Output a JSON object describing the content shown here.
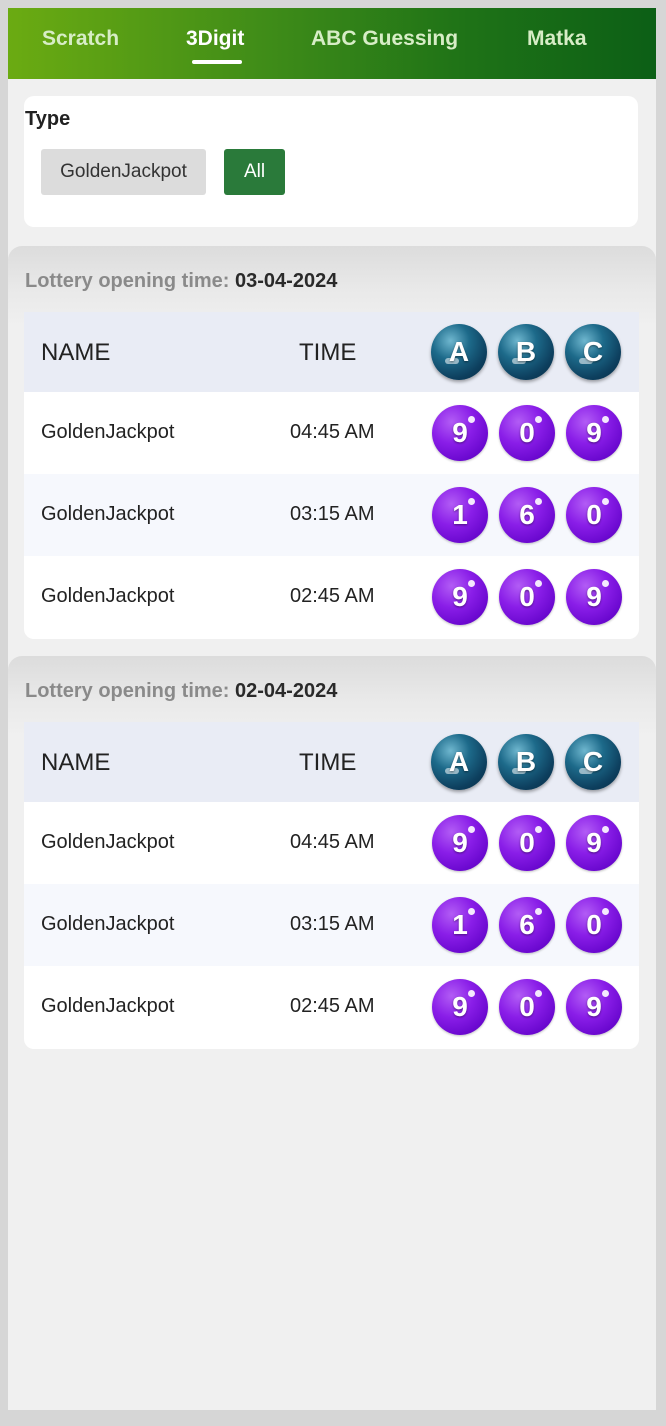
{
  "nav": {
    "tabs": [
      {
        "label": "Scratch"
      },
      {
        "label": "3Digit"
      },
      {
        "label": "ABC Guessing"
      },
      {
        "label": "Matka"
      }
    ],
    "active_index": 1
  },
  "filter": {
    "title": "Type",
    "options": [
      {
        "label": "GoldenJackpot",
        "selected": false
      },
      {
        "label": "All",
        "selected": true
      }
    ]
  },
  "sections": [
    {
      "label": "Lottery opening time:",
      "date": "03-04-2024",
      "headers": {
        "name": "NAME",
        "time": "TIME",
        "a": "A",
        "b": "B",
        "c": "C"
      },
      "rows": [
        {
          "name": "GoldenJackpot",
          "time": "04:45 AM",
          "a": "9",
          "b": "0",
          "c": "9"
        },
        {
          "name": "GoldenJackpot",
          "time": "03:15 AM",
          "a": "1",
          "b": "6",
          "c": "0"
        },
        {
          "name": "GoldenJackpot",
          "time": "02:45 AM",
          "a": "9",
          "b": "0",
          "c": "9"
        }
      ]
    },
    {
      "label": "Lottery opening time:",
      "date": "02-04-2024",
      "headers": {
        "name": "NAME",
        "time": "TIME",
        "a": "A",
        "b": "B",
        "c": "C"
      },
      "rows": [
        {
          "name": "GoldenJackpot",
          "time": "04:45 AM",
          "a": "9",
          "b": "0",
          "c": "9"
        },
        {
          "name": "GoldenJackpot",
          "time": "03:15 AM",
          "a": "1",
          "b": "6",
          "c": "0"
        },
        {
          "name": "GoldenJackpot",
          "time": "02:45 AM",
          "a": "9",
          "b": "0",
          "c": "9"
        }
      ]
    }
  ],
  "colors": {
    "nav_gradient_start": "#6bab12",
    "nav_gradient_end": "#0c5f16",
    "selected_chip": "#2a7a3a",
    "ball_purple": "#8a1ee8",
    "ball_blue": "#0d3f5e"
  }
}
